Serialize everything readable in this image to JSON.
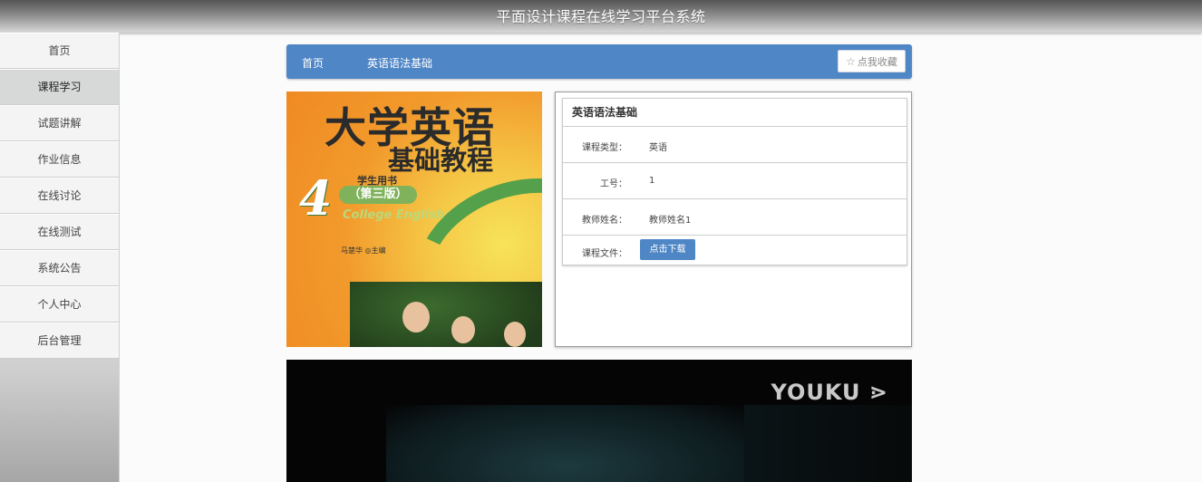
{
  "header": {
    "title": "平面设计课程在线学习平台系统"
  },
  "sidebar": {
    "items": [
      {
        "label": "首页"
      },
      {
        "label": "课程学习"
      },
      {
        "label": "试题讲解"
      },
      {
        "label": "作业信息"
      },
      {
        "label": "在线讨论"
      },
      {
        "label": "在线测试"
      },
      {
        "label": "系统公告"
      },
      {
        "label": "个人中心"
      },
      {
        "label": "后台管理"
      }
    ],
    "active_index": 1
  },
  "breadcrumb": {
    "home": "首页",
    "current": "英语语法基础",
    "favorite_button": "点我收藏",
    "favorite_icon": "star-outline-icon"
  },
  "cover": {
    "title": "大学英语",
    "subtitle": "基础教程",
    "volume": "4",
    "student_book": "学生用书",
    "edition": "（第三版）",
    "english": "College English",
    "author": "马楚华 ◎主编"
  },
  "course": {
    "title": "英语语法基础",
    "fields": [
      {
        "key": "课程类型：",
        "value": "英语"
      },
      {
        "key": "工号：",
        "value": "1"
      },
      {
        "key": "教师姓名：",
        "value": "教师姓名1"
      }
    ],
    "file_label": "课程文件：",
    "download_label": "点击下载"
  },
  "video": {
    "logo": "YOUKU ⋗"
  },
  "colors": {
    "accent": "#4f86c6"
  }
}
